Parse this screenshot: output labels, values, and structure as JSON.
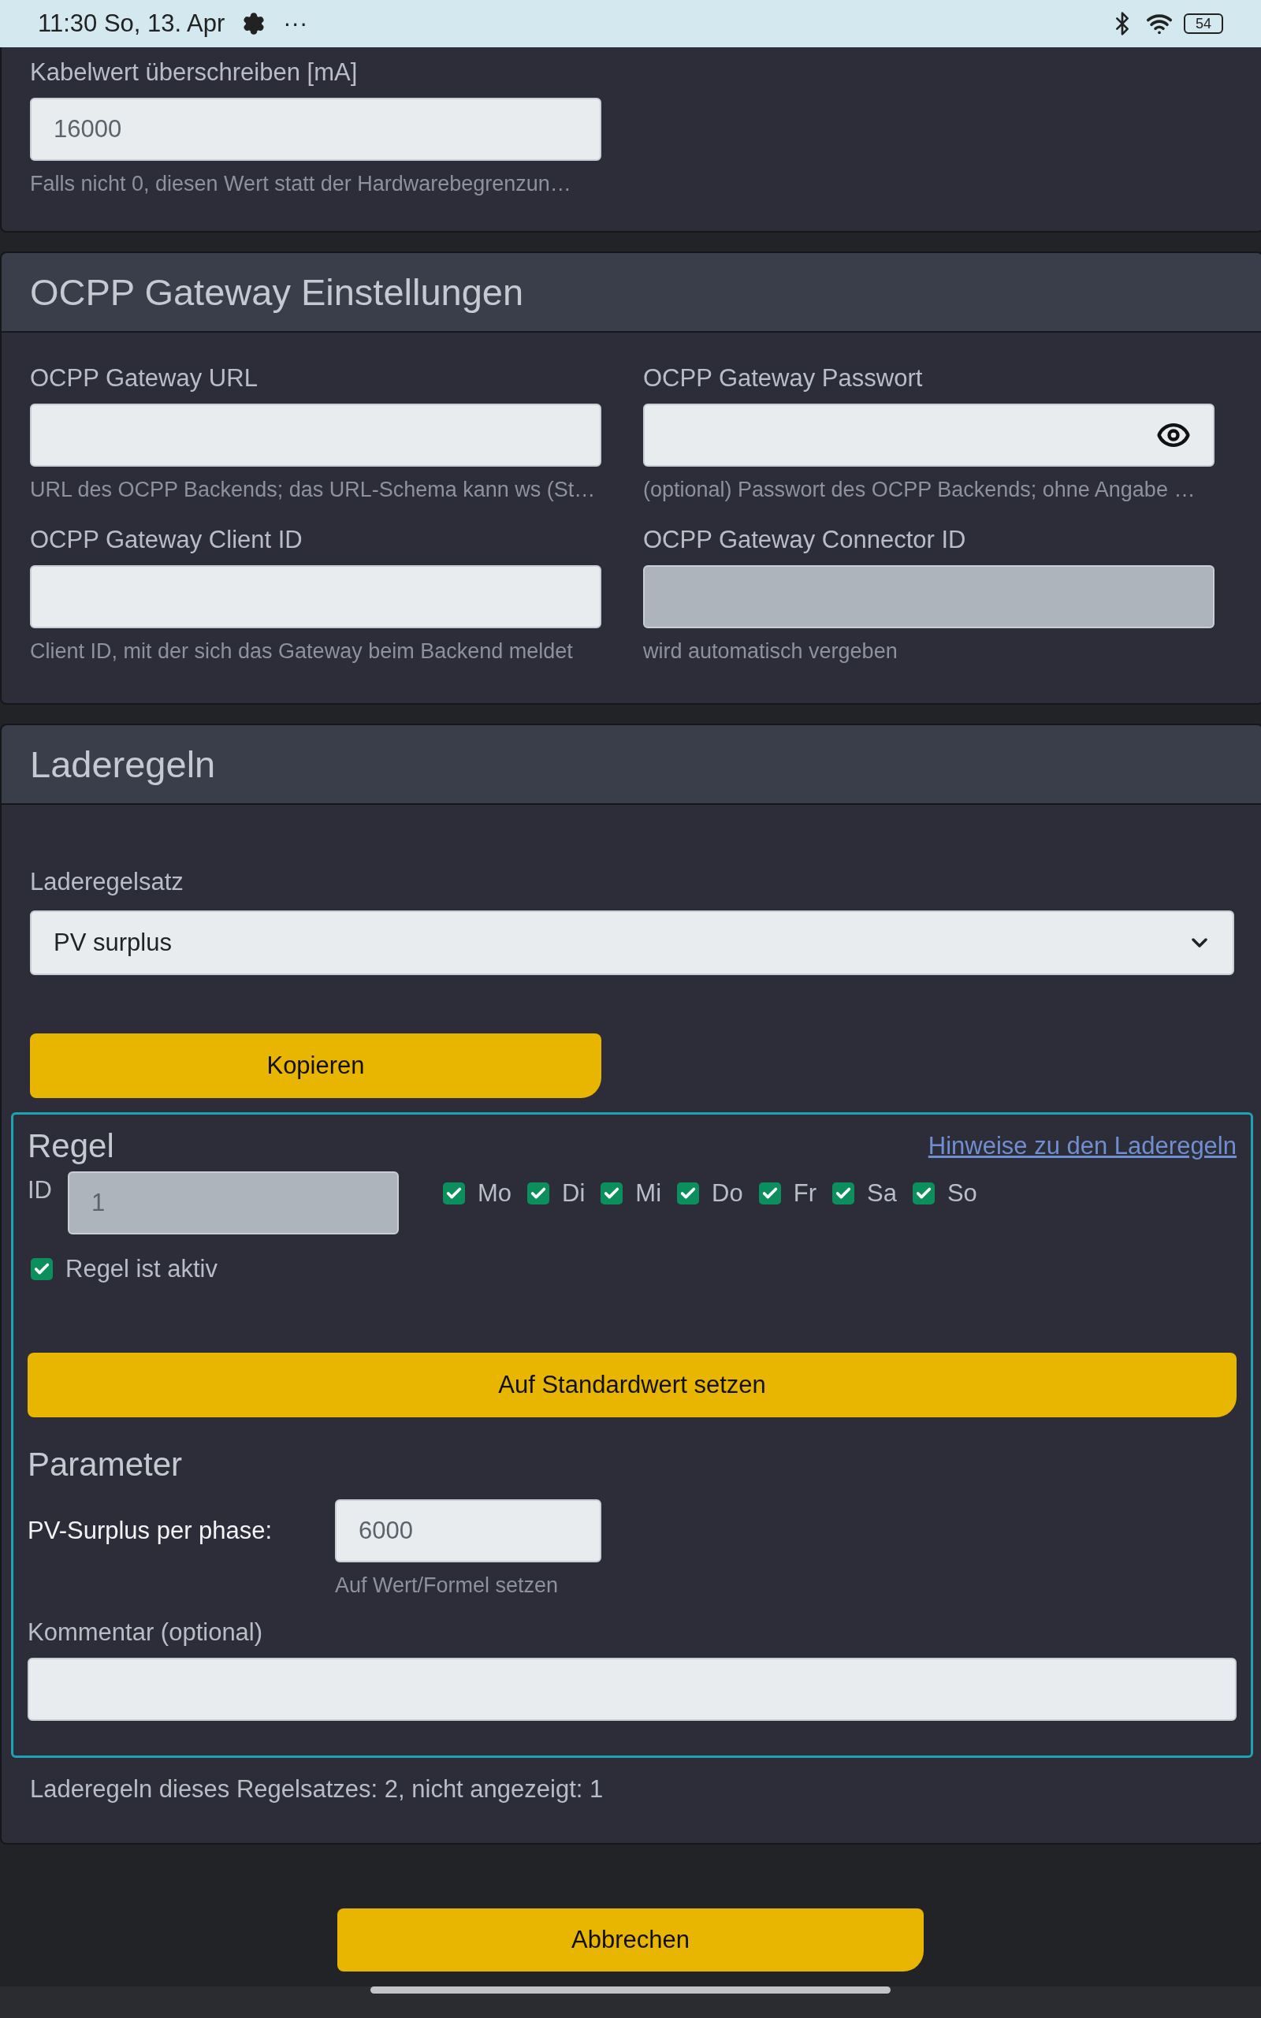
{
  "status_bar": {
    "time": "11:30 So, 13. Apr",
    "more": "···",
    "battery": "54"
  },
  "cable_section": {
    "fields": [
      {
        "label": "Kabelwert überschreiben [mA]",
        "value": "16000",
        "hint": "Falls nicht 0, diesen Wert statt der Hardwarebegrenzun…",
        "disabled": false,
        "kind": "text"
      }
    ]
  },
  "ocpp": {
    "title": "OCPP Gateway Einstellungen",
    "fields": [
      {
        "label": "OCPP Gateway URL",
        "hint": "URL des OCPP Backends; das URL-Schema kann ws (St…",
        "disabled": false,
        "kind": "text"
      },
      {
        "label": "OCPP Gateway Passwort",
        "hint": "(optional) Passwort des OCPP Backends; ohne Angabe …",
        "disabled": false,
        "kind": "password"
      },
      {
        "label": "OCPP Gateway Client ID",
        "hint": "Client ID, mit der sich das Gateway beim Backend meldet",
        "disabled": false,
        "kind": "text"
      },
      {
        "label": "OCPP Gateway Connector ID",
        "hint": "wird automatisch vergeben",
        "disabled": true,
        "kind": "text"
      }
    ]
  },
  "charge_rules": {
    "title": "Laderegeln",
    "ruleset": {
      "label": "Laderegelsatz",
      "value": "PV surplus"
    },
    "copy_button": "Kopieren",
    "rule": {
      "title": "Regel",
      "help_link": "Hinweise zu den Laderegeln",
      "id_label": "ID",
      "id_value": "1",
      "id_disabled": true,
      "days": [
        {
          "label": "Mo",
          "checked": true
        },
        {
          "label": "Di",
          "checked": true
        },
        {
          "label": "Mi",
          "checked": true
        },
        {
          "label": "Do",
          "checked": true
        },
        {
          "label": "Fr",
          "checked": true
        },
        {
          "label": "Sa",
          "checked": true
        },
        {
          "label": "So",
          "checked": true
        }
      ],
      "active": {
        "label": "Regel ist aktiv",
        "checked": true
      },
      "reset_button": "Auf Standardwert setzen",
      "params_title": "Parameter",
      "params": [
        {
          "label": "PV-Surplus per phase:",
          "value": "6000",
          "hint": "Auf Wert/Formel setzen"
        }
      ],
      "comment": {
        "label": "Kommentar (optional)"
      }
    },
    "summary": "Laderegeln dieses Regelsatzes: 2, nicht angezeigt: 1"
  },
  "footer": {
    "cancel_button": "Abbrechen"
  }
}
